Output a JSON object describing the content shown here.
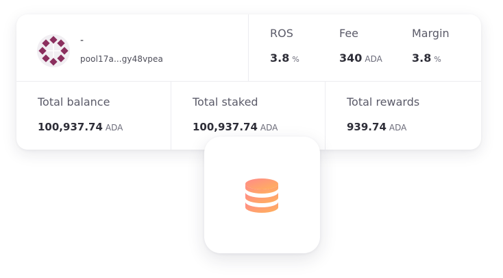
{
  "pool": {
    "name": "-",
    "id": "pool17a...gy48vpea",
    "avatar_icon": "pool-logo-icon"
  },
  "stats": {
    "ros": {
      "label": "ROS",
      "value": "3.8",
      "unit": "%"
    },
    "fee": {
      "label": "Fee",
      "value": "340",
      "unit": "ADA"
    },
    "margin": {
      "label": "Margin",
      "value": "3.8",
      "unit": "%"
    }
  },
  "totals": {
    "balance": {
      "label": "Total balance",
      "value": "100,937.74",
      "unit": "ADA"
    },
    "staked": {
      "label": "Total staked",
      "value": "100,937.74",
      "unit": "ADA"
    },
    "rewards": {
      "label": "Total rewards",
      "value": "939.74",
      "unit": "ADA"
    }
  },
  "tile": {
    "icon": "coin-stack-icon"
  },
  "colors": {
    "logo": "#8b2f5e",
    "gradient_start": "#ff8a8a",
    "gradient_end": "#ffb25a",
    "divider": "#ececf0"
  }
}
